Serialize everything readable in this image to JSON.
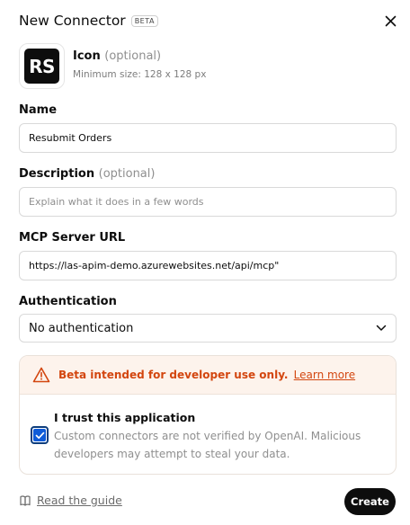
{
  "dialog": {
    "title": "New Connector",
    "badge": "BETA",
    "close_icon": "close-icon"
  },
  "icon_field": {
    "label": "Icon",
    "optional": "(optional)",
    "hint": "Minimum size: 128 x 128 px",
    "tile_text": "RS"
  },
  "name_field": {
    "label": "Name",
    "value": "Resubmit Orders"
  },
  "description_field": {
    "label": "Description",
    "optional": "(optional)",
    "placeholder": "Explain what it does in a few words"
  },
  "url_field": {
    "label": "MCP Server URL",
    "value": "https://las-apim-demo.azurewebsites.net/api/mcp\""
  },
  "auth_field": {
    "label": "Authentication",
    "value": "No authentication",
    "icon": "chevron-down-icon"
  },
  "warning": {
    "text": "Beta intended for developer use only.",
    "link": "Learn more",
    "icon": "warning-triangle-icon",
    "color": "#d3460f",
    "background": "#fdf3ec"
  },
  "trust": {
    "checked": true,
    "title": "I trust this application",
    "description": "Custom connectors are not verified by OpenAI. Malicious developers may attempt to steal your data."
  },
  "footer": {
    "guide_label": "Read the guide",
    "guide_icon": "book-icon",
    "create_label": "Create"
  }
}
